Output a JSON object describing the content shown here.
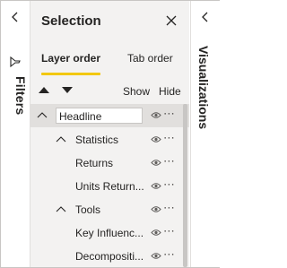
{
  "filters": {
    "label": "Filters"
  },
  "selection": {
    "title": "Selection",
    "tabs": [
      {
        "label": "Layer order",
        "active": true
      },
      {
        "label": "Tab order",
        "active": false
      }
    ],
    "show_label": "Show",
    "hide_label": "Hide",
    "items": [
      {
        "label": "Headline",
        "level": 0,
        "expanded": true,
        "editing": true
      },
      {
        "label": "Statistics",
        "level": 1,
        "expanded": true
      },
      {
        "label": "Returns",
        "level": 2
      },
      {
        "label": "Units Return...",
        "level": 2
      },
      {
        "label": "Tools",
        "level": 1,
        "expanded": true
      },
      {
        "label": "Key Influenc...",
        "level": 2
      },
      {
        "label": "Decompositi...",
        "level": 2
      }
    ],
    "more_label": "⋯"
  },
  "visualizations": {
    "label": "Visualizations"
  },
  "colors": {
    "accent": "#f2c811",
    "pane": "#f3f2f1",
    "selected_row": "#e1dfdd"
  }
}
